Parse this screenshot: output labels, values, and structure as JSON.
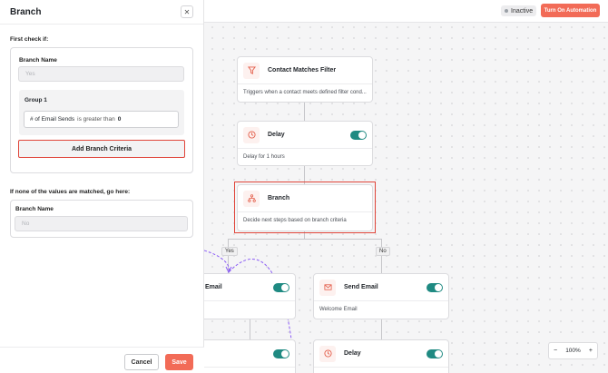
{
  "topbar": {
    "status_label": "Inactive",
    "turn_on_label": "Turn On Automation"
  },
  "panel": {
    "title": "Branch",
    "first_check_label": "First check if:",
    "branch_name_label": "Branch Name",
    "branch_name_placeholder": "Yes",
    "group_title": "Group 1",
    "condition": {
      "field": "# of Email Sends",
      "operator": "is greater than",
      "value": "0"
    },
    "add_criteria_label": "Add Branch Criteria",
    "fallback_label": "If none of the values are matched, go here:",
    "fallback_branch_name_label": "Branch Name",
    "fallback_branch_name_placeholder": "No",
    "cancel_label": "Cancel",
    "save_label": "Save"
  },
  "nodes": {
    "filter": {
      "title": "Contact Matches Filter",
      "desc": "Triggers when a contact meets defined filter cond..."
    },
    "delay1": {
      "title": "Delay",
      "desc": "Delay for 1 hours",
      "enabled": true
    },
    "branch": {
      "title": "Branch",
      "desc": "Decide next steps based on branch criteria"
    },
    "send_email_left": {
      "title": "Email",
      "enabled": true
    },
    "send_email_right": {
      "title": "Send Email",
      "desc": "Welcome Email",
      "enabled": true
    },
    "delay_left": {
      "enabled": true
    },
    "delay_right": {
      "title": "Delay",
      "enabled": true
    }
  },
  "branch_labels": {
    "yes": "Yes",
    "no": "No"
  },
  "zoom": {
    "level": "100%",
    "minus": "−",
    "plus": "+"
  },
  "colors": {
    "accent": "#f26b57",
    "toggle": "#1f8a82",
    "highlight": "#e0453a"
  }
}
